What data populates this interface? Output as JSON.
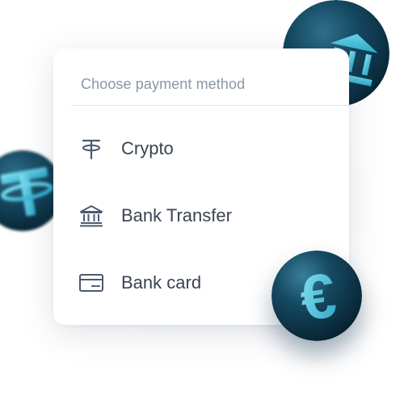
{
  "payment": {
    "title": "Choose payment method",
    "options": [
      {
        "label": "Crypto",
        "icon": "tether-icon"
      },
      {
        "label": "Bank Transfer",
        "icon": "bank-icon"
      },
      {
        "label": "Bank card",
        "icon": "credit-card-icon"
      }
    ]
  },
  "decorations": {
    "coins": [
      "bank-coin",
      "tether-coin",
      "euro-coin"
    ],
    "euro_symbol": "€"
  },
  "colors": {
    "accent": "#4fc3dc",
    "coin_dark": "#0f3a4f",
    "text": "#3a4352",
    "muted": "#8b96a6",
    "icon": "#4a5a72"
  }
}
